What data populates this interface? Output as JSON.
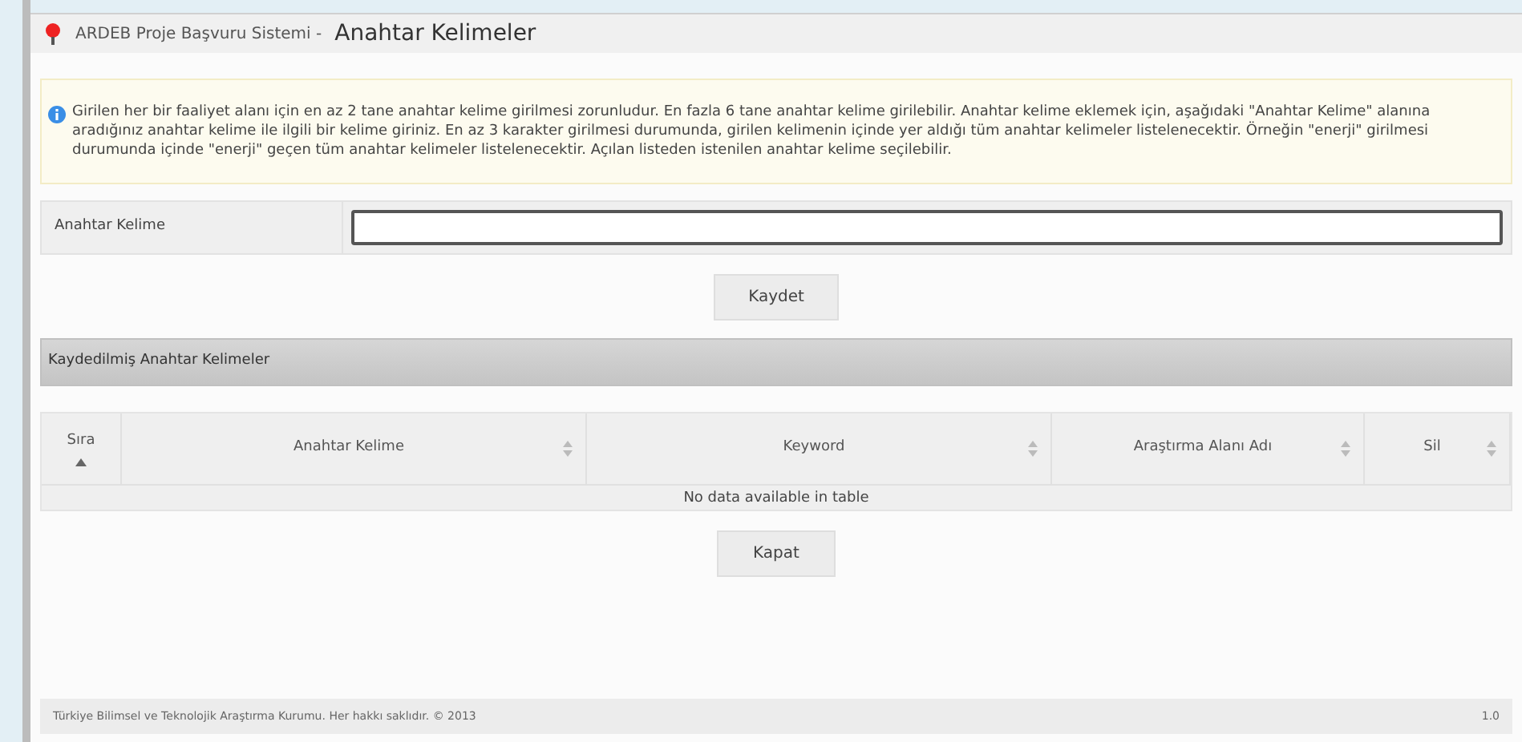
{
  "window": {
    "title_prefix": "ARDEB Proje Başvuru Sistemi -",
    "title": "Anahtar Kelimeler"
  },
  "info": {
    "text": "Girilen her bir faaliyet alanı için en az 2 tane anahtar kelime girilmesi zorunludur. En fazla 6 tane anahtar kelime girilebilir. Anahtar kelime eklemek için, aşağıdaki \"Anahtar Kelime\" alanına aradığınız anahtar kelime ile ilgili bir kelime giriniz. En az 3 karakter girilmesi durumunda, girilen kelimenin içinde yer aldığı tüm anahtar kelimeler listelenecektir. Örneğin \"enerji\" girilmesi durumunda içinde \"enerji\" geçen tüm anahtar kelimeler listelenecektir. Açılan listeden istenilen anahtar kelime seçilebilir."
  },
  "form": {
    "label": "Anahtar Kelime"
  },
  "save_button": "Kaydet",
  "section": {
    "title": "Kaydedilmiş Anahtar Kelimeler"
  },
  "table": {
    "columns": [
      {
        "label": "Sıra",
        "sorted": true
      },
      {
        "label": "Anahtar Kelime",
        "sorted": false
      },
      {
        "label": "Keyword",
        "sorted": false
      },
      {
        "label": "Araştırma Alanı Adı",
        "sorted": false
      },
      {
        "label": "Sil",
        "sorted": false
      }
    ],
    "empty": "No data available in table"
  },
  "close_button": "Kapat",
  "status_bar": {
    "copyright": "Türkiye Bilimsel ve Teknolojik Araştırma Kurumu. Her hakkı saklıdır. © 2013",
    "version": "1.0"
  }
}
